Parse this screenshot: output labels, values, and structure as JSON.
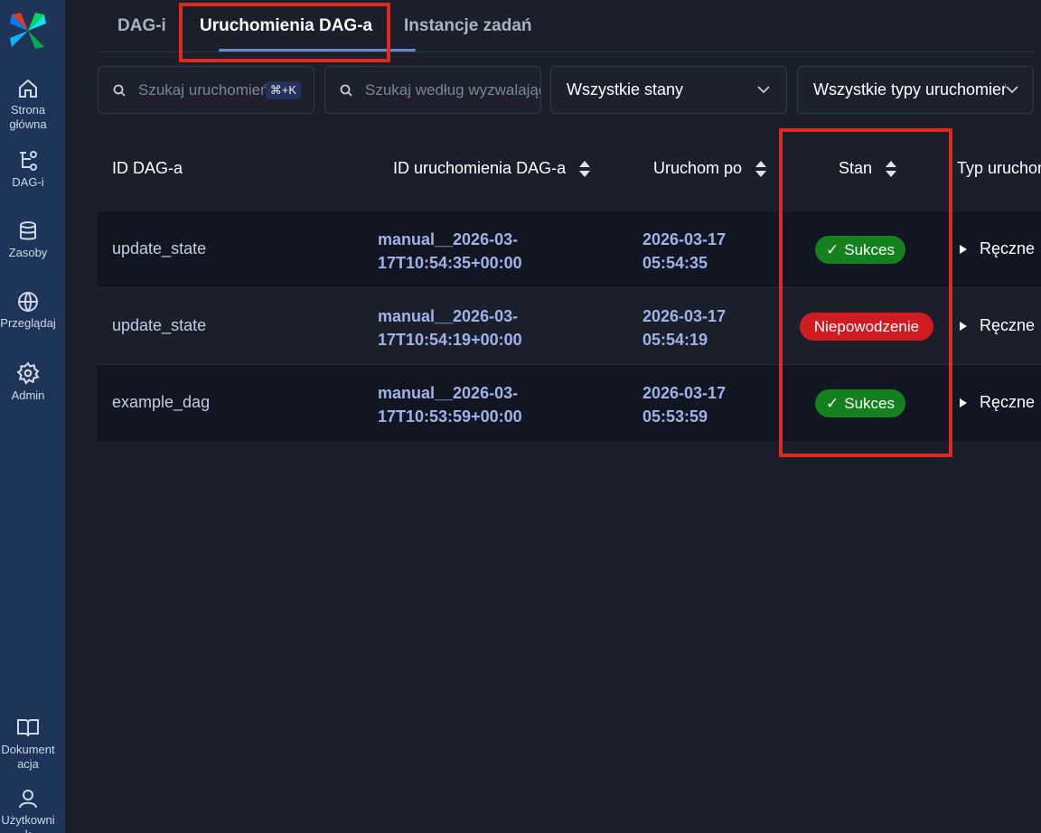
{
  "sidebar": {
    "items": [
      {
        "label": "Strona główna",
        "icon": "home-icon"
      },
      {
        "label": "DAG-i",
        "icon": "dag-icon"
      },
      {
        "label": "Zasoby",
        "icon": "database-icon"
      },
      {
        "label": "Przeglądaj",
        "icon": "globe-icon"
      },
      {
        "label": "Admin",
        "icon": "gear-icon"
      }
    ],
    "bottom_items": [
      {
        "label": "Dokumentacja",
        "icon": "book-icon"
      },
      {
        "label": "Użytkownik",
        "icon": "user-icon"
      }
    ]
  },
  "tabs": [
    {
      "label": "DAG-i"
    },
    {
      "label": "Uruchomienia DAG-a",
      "active": true
    },
    {
      "label": "Instancje zadań"
    }
  ],
  "filters": {
    "search_runs_placeholder": "Szukaj uruchomień",
    "shortcut": "⌘+K",
    "search_trigger_placeholder": "Szukaj według wyzwalającego",
    "state_select": "Wszystkie stany",
    "run_type_select": "Wszystkie typy uruchomień"
  },
  "table": {
    "headers": {
      "dag_id": "ID DAG-a",
      "run_id": "ID uruchomienia DAG-a",
      "run_after": "Uruchom po",
      "state": "Stan",
      "run_type": "Typ uruchomienia"
    },
    "rows": [
      {
        "dag_id": "update_state",
        "run_id_1": "manual__2026-03-",
        "run_id_2": "17T10:54:35+00:00",
        "run_after_1": "2026-03-17",
        "run_after_2": "05:54:35",
        "state": "Sukces",
        "run_type": "Ręczne"
      },
      {
        "dag_id": "update_state",
        "run_id_1": "manual__2026-03-",
        "run_id_2": "17T10:54:19+00:00",
        "run_after_1": "2026-03-17",
        "run_after_2": "05:54:19",
        "state": "Niepowodzenie",
        "run_type": "Ręczne"
      },
      {
        "dag_id": "example_dag",
        "run_id_1": "manual__2026-03-",
        "run_id_2": "17T10:53:59+00:00",
        "run_after_1": "2026-03-17",
        "run_after_2": "05:53:59",
        "state": "Sukces",
        "run_type": "Ręczne"
      }
    ]
  },
  "colors": {
    "sidebar_bg": "#1e3458",
    "page_bg": "#1b1f2c",
    "success": "#14811e",
    "failed": "#cf1b22",
    "highlight": "#e02a1d"
  }
}
